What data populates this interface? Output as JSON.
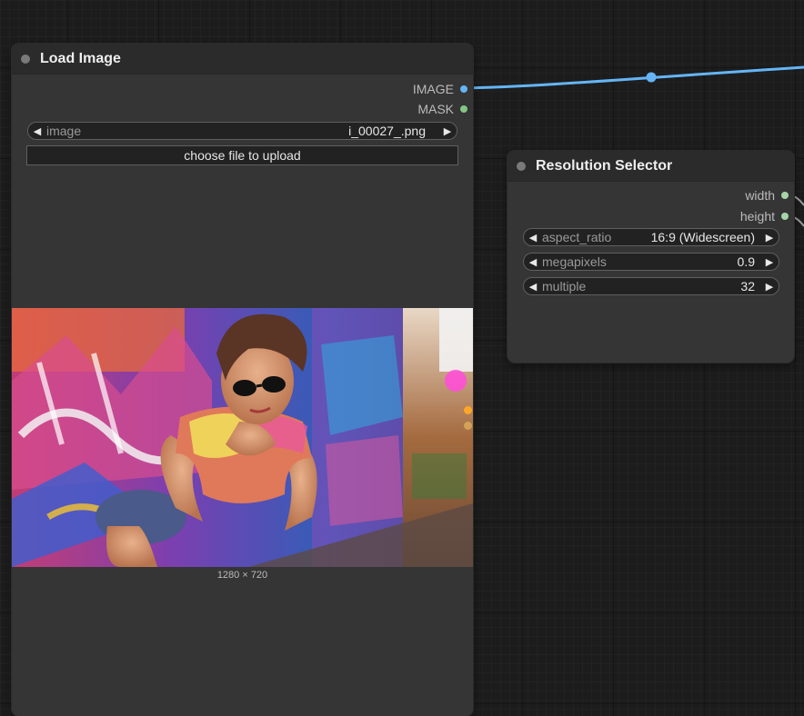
{
  "load_image": {
    "title": "Load Image",
    "outputs": [
      {
        "label": "IMAGE",
        "color": "#64b5f6"
      },
      {
        "label": "MASK",
        "color": "#81c784"
      }
    ],
    "image_widget": {
      "label": "image",
      "value": "i_00027_.png"
    },
    "upload_button": "choose file to upload",
    "preview_caption": "1280 × 720"
  },
  "resolution_selector": {
    "title": "Resolution Selector",
    "outputs": [
      {
        "label": "width",
        "color": "#a5d6a7"
      },
      {
        "label": "height",
        "color": "#a5d6a7"
      }
    ],
    "widgets": [
      {
        "label": "aspect_ratio",
        "value": "16:9 (Widescreen)"
      },
      {
        "label": "megapixels",
        "value": "0.9"
      },
      {
        "label": "multiple",
        "value": "32"
      }
    ]
  },
  "icons": {
    "left_arrow": "◀",
    "right_arrow": "▶"
  },
  "colors": {
    "link_image": "#64b5f6",
    "link_other": "#9e9e9e",
    "socket_orange": "#ffa726",
    "socket_yellow": "#d4a257"
  }
}
